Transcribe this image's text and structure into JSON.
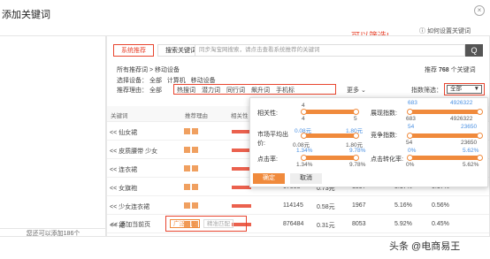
{
  "dialog": {
    "title": "添加关键词",
    "help_label": "如何设置关键词",
    "close_label": "×",
    "left_footer": "您还可以添加186个"
  },
  "annotation": "可以筛选!",
  "tabs": [
    {
      "label": "系统推荐"
    },
    {
      "label": "搜索关键词"
    }
  ],
  "search": {
    "placeholder": "同步淘宝网搜索，请点击查看系统推荐的关键词",
    "button_label": "Q"
  },
  "breadcrumb": "所有推荐词 > 移动设备",
  "count_prefix": "推荐",
  "count_value": "768",
  "count_suffix": "个关键词",
  "device": {
    "label": "选择设备：",
    "options": [
      "全部",
      "计算机",
      "移动设备"
    ]
  },
  "reason": {
    "label": "推荐理由：",
    "options": [
      "全部",
      "热搜词",
      "潜力词",
      "同行词",
      "飙升词",
      "手机标"
    ],
    "more": "更多"
  },
  "filter": {
    "label": "指数筛选：",
    "value": "全部"
  },
  "table": {
    "headers": [
      "关键词",
      "推荐理由",
      "相关性",
      "展现指数",
      "市场平均出价",
      "竞争指数",
      "点击率",
      "点击转化率"
    ],
    "rows": [
      {
        "keyword": "<< 仙女裙",
        "impressions": "",
        "bid": "",
        "comp": "",
        "ctr": "",
        "cvr": ""
      },
      {
        "keyword": "<< 皮质腰带 少女",
        "impressions": "",
        "bid": "",
        "comp": "",
        "ctr": "",
        "cvr": ""
      },
      {
        "keyword": "<< 连衣裙",
        "impressions": "",
        "bid": "",
        "comp": "",
        "ctr": "",
        "cvr": ""
      },
      {
        "keyword": "<< 女旗袍",
        "impressions": "67008",
        "bid": "0.73元",
        "comp": "1597",
        "ctr": "5.17%",
        "cvr": "0.17%"
      },
      {
        "keyword": "<< 少女连衣裙",
        "impressions": "114145",
        "bid": "0.58元",
        "comp": "1967",
        "ctr": "5.16%",
        "cvr": "0.56%"
      },
      {
        "keyword": "<< 裙",
        "impressions": "876484",
        "bid": "0.31元",
        "comp": "8053",
        "ctr": "5.92%",
        "cvr": "0.45%"
      }
    ]
  },
  "bottom": {
    "add_page": "<< 添加当前页",
    "broad": "广泛匹配",
    "exact": "精准匹配"
  },
  "popup": {
    "relevance": {
      "label": "相关性:",
      "min": "4",
      "max": "5"
    },
    "impressions": {
      "label": "展现指数:",
      "min": "683",
      "max": "4926322",
      "min2": "683",
      "max2": "4926322"
    },
    "bid": {
      "label": "市场平均出价:",
      "min": "0.08元",
      "max": "1.80元",
      "min2": "0.08元",
      "max2": "1.80元"
    },
    "comp": {
      "label": "竞争指数:",
      "min": "54",
      "max": "23650",
      "min2": "54",
      "max2": "23650"
    },
    "ctr": {
      "label": "点击率:",
      "min": "1.34%",
      "max": "9.78%",
      "min2": "1.34%",
      "max2": "9.78%"
    },
    "cvr": {
      "label": "点击转化率:",
      "min": "0%",
      "max": "5.62%",
      "min2": "0%",
      "max2": "5.62%"
    },
    "ok": "确定",
    "cancel": "取消"
  },
  "watermark": "头条 @电商易王",
  "colors": {
    "accent": "#e8452f",
    "orange": "#f08a3c"
  }
}
